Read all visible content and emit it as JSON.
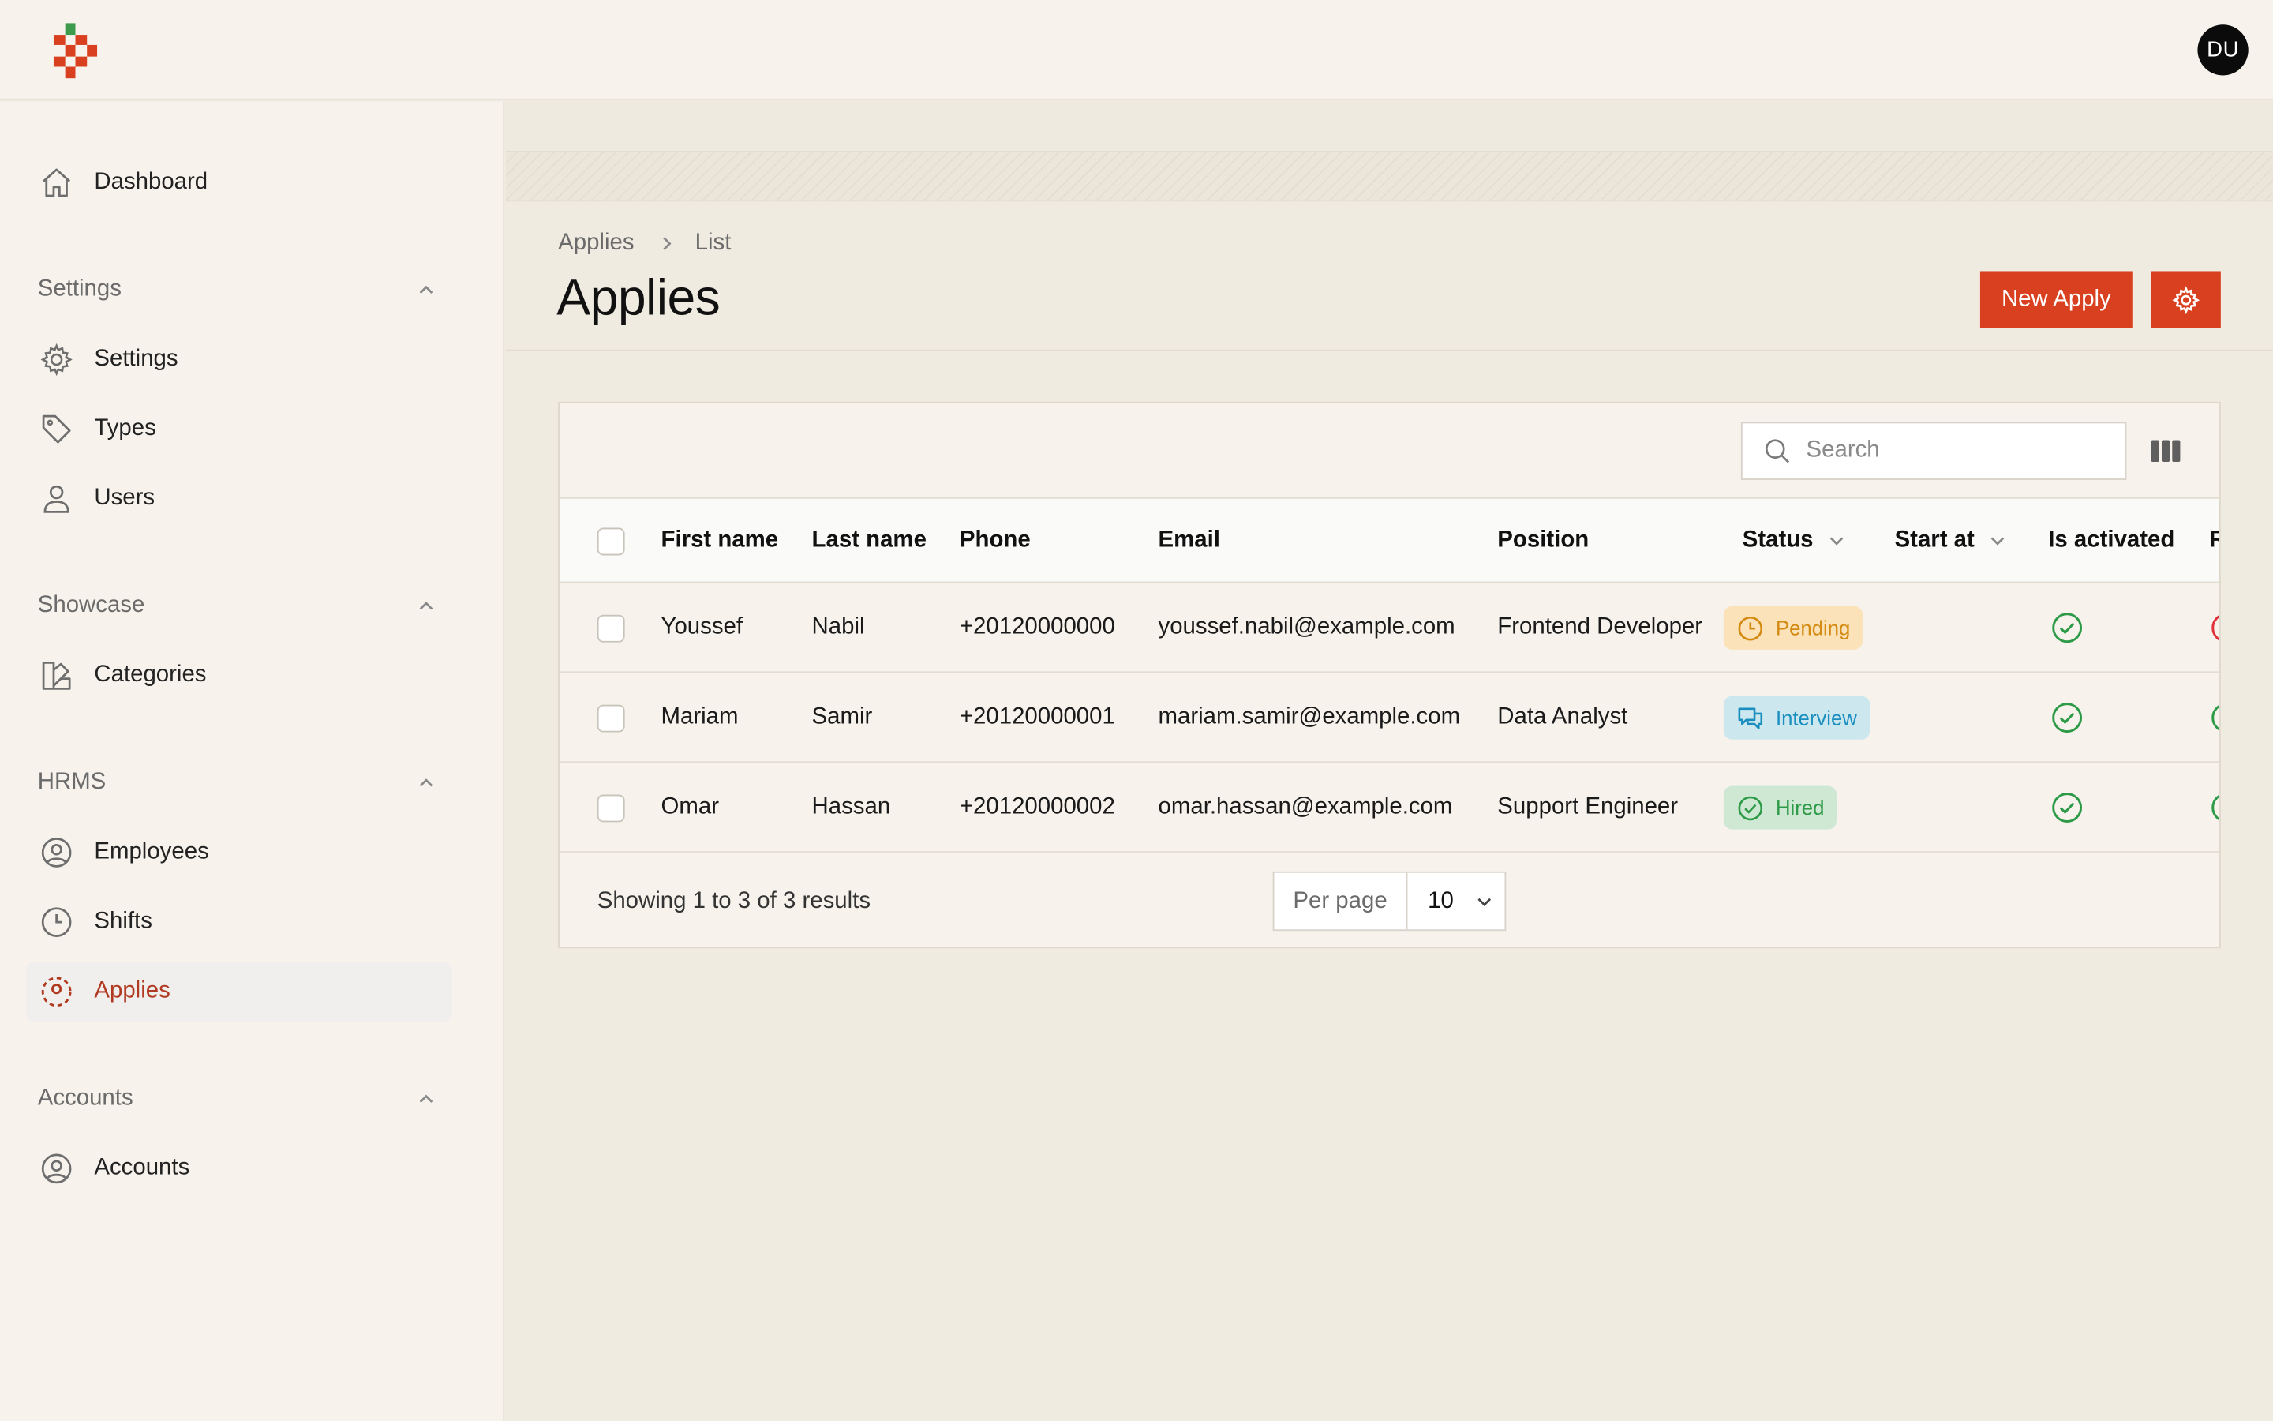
{
  "user": {
    "initials": "DU"
  },
  "nav": {
    "dashboard": "Dashboard",
    "groups": {
      "settings": {
        "label": "Settings",
        "items": [
          "Settings",
          "Types",
          "Users"
        ]
      },
      "showcase": {
        "label": "Showcase",
        "items": [
          "Categories"
        ]
      },
      "hrms": {
        "label": "HRMS",
        "items": [
          "Employees",
          "Shifts",
          "Applies"
        ]
      },
      "accounts": {
        "label": "Accounts",
        "items": [
          "Accounts"
        ]
      }
    },
    "active_item": "Applies"
  },
  "breadcrumb": {
    "parent": "Applies",
    "current": "List"
  },
  "page": {
    "title": "Applies",
    "new_button": "New Apply"
  },
  "search": {
    "placeholder": "Search",
    "value": ""
  },
  "table": {
    "columns": [
      "First name",
      "Last name",
      "Phone",
      "Email",
      "Position",
      "Status",
      "Start at",
      "Is activated",
      "R"
    ],
    "rows": [
      {
        "first_name": "Youssef",
        "last_name": "Nabil",
        "phone": "+20120000000",
        "email": "youssef.nabil@example.com",
        "position": "Frontend Developer",
        "status": "Pending"
      },
      {
        "first_name": "Mariam",
        "last_name": "Samir",
        "phone": "+20120000001",
        "email": "mariam.samir@example.com",
        "position": "Data Analyst",
        "status": "Interview"
      },
      {
        "first_name": "Omar",
        "last_name": "Hassan",
        "phone": "+20120000002",
        "email": "omar.hassan@example.com",
        "position": "Support Engineer",
        "status": "Hired"
      }
    ]
  },
  "pagination": {
    "summary": "Showing 1 to 3 of 3 results",
    "per_page_label": "Per page",
    "per_page_value": "10"
  },
  "colors": {
    "accent": "#d9401f",
    "active_nav": "#b13a22",
    "pending": "#d48a10",
    "interview": "#1a8fbf",
    "hired": "#2d9a47",
    "danger": "#e0303a"
  }
}
